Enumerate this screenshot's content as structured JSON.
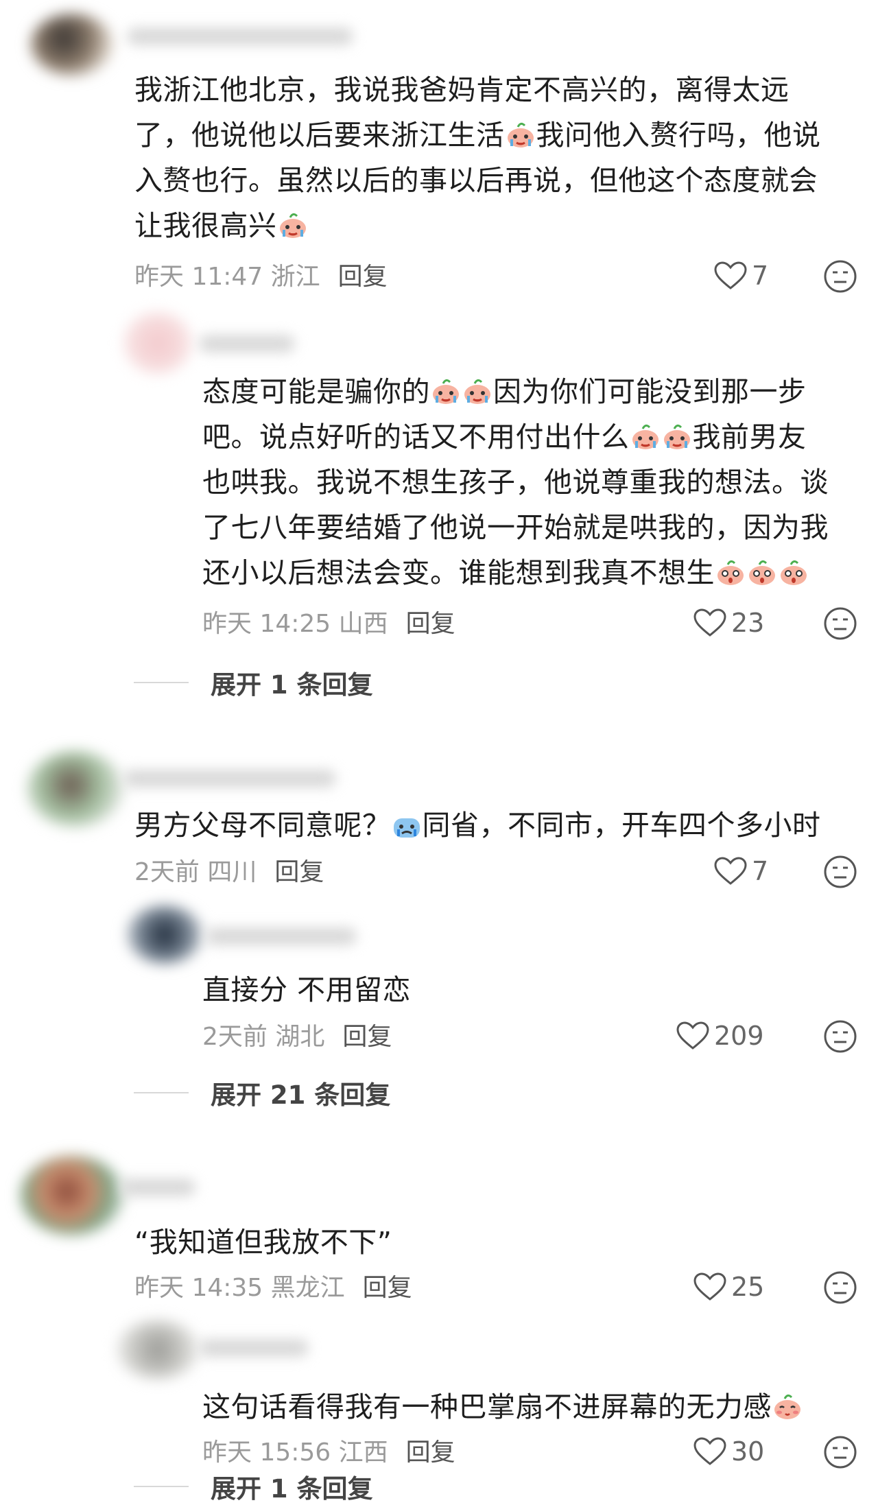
{
  "comments": [
    {
      "text_lines": [
        "我浙江他北京，我说我爸妈肯定不高兴的，离得太远",
        "了，他说他以后要来浙江生活",
        "我问他入赘行吗，他说",
        "入赘也行。虽然以后的事以后再说，但他这个态度就会",
        "让我很高兴"
      ],
      "meta": "昨天 11:47 浙江",
      "reply_label": "回复",
      "likes": "7"
    },
    {
      "text_lines": [
        "态度可能是骗你的",
        "因为你们可能没到那一步",
        "吧。说点好听的话又不用付出什么",
        "我前男友",
        "也哄我。我说不想生孩子，他说尊重我的想法。谈",
        "了七八年要结婚了他说一开始就是哄我的，因为我",
        "还小以后想法会变。谁能想到我真不想生"
      ],
      "meta": "昨天 14:25 山西",
      "reply_label": "回复",
      "likes": "23",
      "expand": "展开 1 条回复"
    },
    {
      "text_lines": [
        "男方父母不同意呢？",
        "同省，不同市，开车四个多小时"
      ],
      "meta": "2天前 四川",
      "reply_label": "回复",
      "likes": "7"
    },
    {
      "text_lines": [
        "直接分 不用留恋"
      ],
      "meta": "2天前 湖北",
      "reply_label": "回复",
      "likes": "209",
      "expand": "展开 21 条回复"
    },
    {
      "text_lines": [
        "“我知道但我放不下”"
      ],
      "meta": "昨天 14:35 黑龙江",
      "reply_label": "回复",
      "likes": "25"
    },
    {
      "text_lines": [
        "这句话看得我有一种巴掌扇不进屏幕的无力感"
      ],
      "meta": "昨天 15:56 江西",
      "reply_label": "回复",
      "likes": "30",
      "expand": "展开 1 条回复"
    }
  ],
  "icons": {
    "like": "heart-outline-icon",
    "dislike": "meh-face-icon",
    "emoji": "crying-peach-emoji"
  },
  "colors": {
    "text": "#1e1e1e",
    "meta": "#9a9a9a",
    "reply": "#555555",
    "emoji": "#f6a38d"
  }
}
